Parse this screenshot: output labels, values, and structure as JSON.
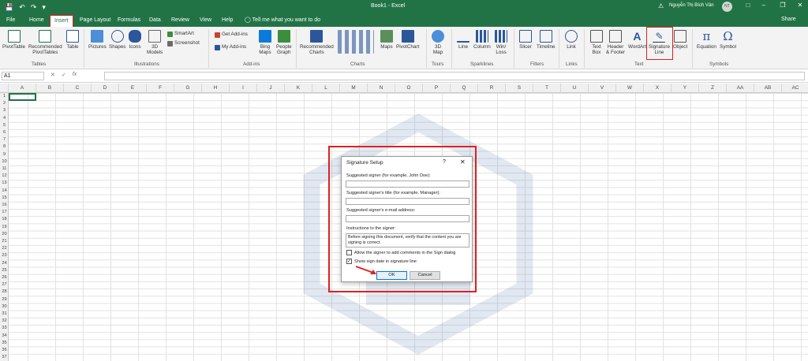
{
  "window": {
    "title": "Book1  -  Excel",
    "user_name": "Nguyễn Thị Bích Vân",
    "user_initials": "NT",
    "qat": {
      "save_icon": "save-icon",
      "undo_icon": "undo-icon",
      "redo_icon": "redo-icon",
      "customize_icon": "customize-icon"
    }
  },
  "tabs": [
    "File",
    "Home",
    "Insert",
    "Page Layout",
    "Formulas",
    "Data",
    "Review",
    "View",
    "Help"
  ],
  "active_tab": "Insert",
  "tell_me": "Tell me what you want to do",
  "share_label": "Share",
  "ribbon": {
    "tables": {
      "pivottable": "PivotTable",
      "recommended": "Recommended",
      "recommended2": "PivotTables",
      "table": "Table",
      "group": "Tables"
    },
    "illustrations": {
      "pictures": "Pictures",
      "shapes": "Shapes",
      "icons": "Icons",
      "models": "3D",
      "models2": "Models",
      "smartart": "SmartArt",
      "screenshot": "Screenshot",
      "group": "Illustrations"
    },
    "addins": {
      "get": "Get Add-ins",
      "my": "My Add-ins",
      "bing": "Bing",
      "bing2": "Maps",
      "people": "People",
      "people2": "Graph",
      "group": "Add-ins"
    },
    "charts": {
      "recommended": "Recommended",
      "recommended2": "Charts",
      "maps": "Maps",
      "pivotchart": "PivotChart",
      "group": "Charts"
    },
    "tours": {
      "map3d": "3D",
      "map3d2": "Map",
      "group": "Tours"
    },
    "sparklines": {
      "line": "Line",
      "column": "Column",
      "winloss": "Win/",
      "winloss2": "Loss",
      "group": "Sparklines"
    },
    "filters": {
      "slicer": "Slicer",
      "timeline": "Timeline",
      "group": "Filters"
    },
    "links": {
      "link": "Link",
      "group": "Links"
    },
    "text": {
      "textbox": "Text",
      "textbox2": "Box",
      "header": "Header",
      "header2": "& Footer",
      "wordart": "WordArt",
      "signature": "Signature",
      "signature2": "Line",
      "object": "Object",
      "group": "Text"
    },
    "symbols": {
      "equation": "Equation",
      "symbol": "Symbol",
      "group": "Symbols"
    }
  },
  "formula_bar": {
    "name_box": "A1",
    "fx": "fx",
    "value": ""
  },
  "columns": [
    "A",
    "B",
    "C",
    "D",
    "E",
    "F",
    "G",
    "H",
    "I",
    "J",
    "K",
    "L",
    "M",
    "N",
    "O",
    "P",
    "Q",
    "R",
    "S",
    "T",
    "U",
    "V",
    "W",
    "X",
    "Y",
    "Z",
    "AA",
    "AB",
    "AC"
  ],
  "rows": [
    "1",
    "2",
    "3",
    "4",
    "5",
    "6",
    "7",
    "8",
    "9",
    "10",
    "11",
    "12",
    "13",
    "14",
    "15",
    "16",
    "17",
    "18",
    "19",
    "20",
    "21",
    "22",
    "23",
    "24",
    "25",
    "26",
    "27",
    "28",
    "29",
    "30",
    "31",
    "32",
    "33",
    "34",
    "35",
    "36",
    "37"
  ],
  "dialog": {
    "title": "Signature Setup",
    "help": "?",
    "signer_label": "Suggested signer (for example, John Doe):",
    "signer_value": "",
    "signer_title_label": "Suggested signer's title (for example, Manager):",
    "signer_title_value": "",
    "email_label": "Suggested signer's e-mail address:",
    "email_value": "",
    "instructions_label": "Instructions to the signer:",
    "instructions_value": "Before signing this document, verify that the content you are signing is correct.",
    "allow_comments_label": "Allow the signer to add comments in the Sign dialog",
    "allow_comments_checked": false,
    "show_date_label": "Show sign date in signature line",
    "show_date_checked": true,
    "ok_label": "OK",
    "cancel_label": "Cancel"
  },
  "colors": {
    "excel_green": "#217346",
    "highlight_red": "#e02020",
    "ok_blue": "#0078d7"
  }
}
